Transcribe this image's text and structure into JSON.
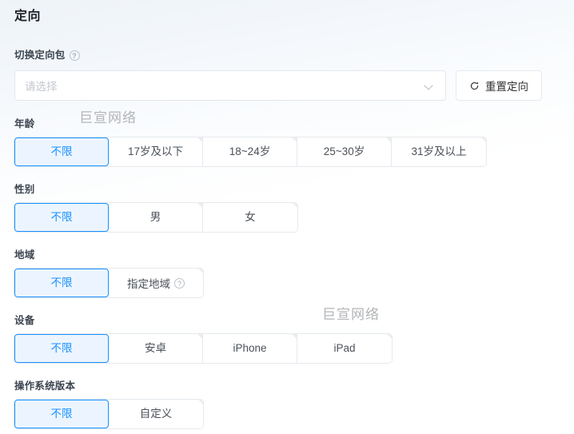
{
  "page": {
    "title": "定向"
  },
  "switch_package": {
    "label": "切换定向包",
    "help_icon": "question-circle-icon",
    "select_placeholder": "请选择",
    "chevron_icon": "chevron-down-icon",
    "reset_label": "重置定向",
    "reset_icon": "refresh-icon"
  },
  "groups": [
    {
      "key": "age",
      "label": "年龄",
      "options": [
        {
          "label": "不限",
          "selected": true
        },
        {
          "label": "17岁及以下",
          "selected": false
        },
        {
          "label": "18~24岁",
          "selected": false
        },
        {
          "label": "25~30岁",
          "selected": false
        },
        {
          "label": "31岁及以上",
          "selected": false
        }
      ]
    },
    {
      "key": "gender",
      "label": "性别",
      "options": [
        {
          "label": "不限",
          "selected": true
        },
        {
          "label": "男",
          "selected": false
        },
        {
          "label": "女",
          "selected": false
        }
      ]
    },
    {
      "key": "region",
      "label": "地域",
      "options": [
        {
          "label": "不限",
          "selected": true
        },
        {
          "label": "指定地域",
          "selected": false,
          "help_icon": "question-circle-icon"
        }
      ]
    },
    {
      "key": "device",
      "label": "设备",
      "options": [
        {
          "label": "不限",
          "selected": true
        },
        {
          "label": "安卓",
          "selected": false
        },
        {
          "label": "iPhone",
          "selected": false
        },
        {
          "label": "iPad",
          "selected": false
        }
      ]
    },
    {
      "key": "os_version",
      "label": "操作系统版本",
      "options": [
        {
          "label": "不限",
          "selected": true
        },
        {
          "label": "自定义",
          "selected": false
        }
      ]
    }
  ],
  "watermarks": [
    {
      "text": "巨宣网络"
    },
    {
      "text": "巨宣网络"
    }
  ],
  "colors": {
    "accent": "#1890ff",
    "selected_bg": "#ecf5ff",
    "border": "#e6e9ee",
    "text": "#303133",
    "placeholder": "#c3c7ce",
    "watermark": "#b3b5b8"
  }
}
